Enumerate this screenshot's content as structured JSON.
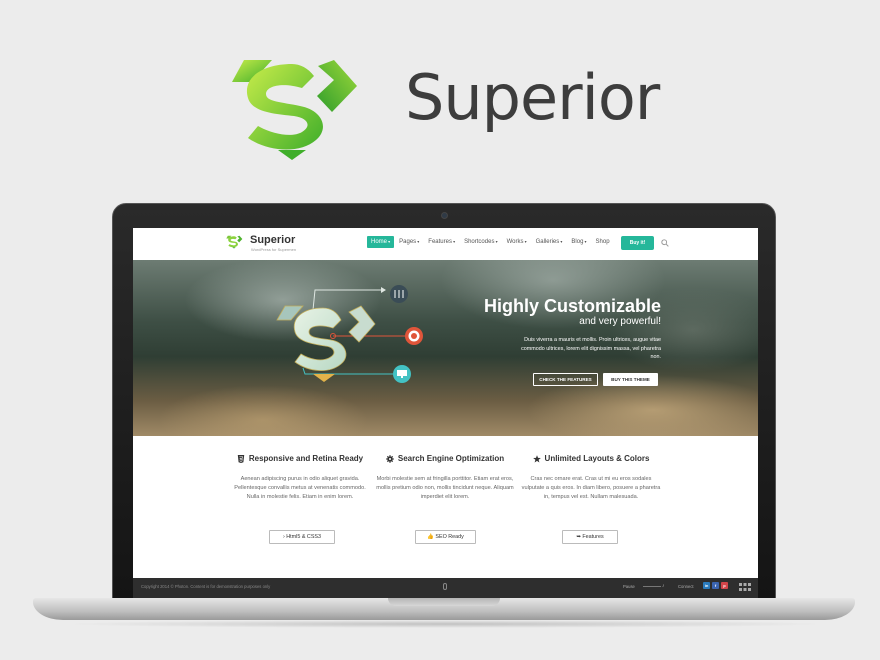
{
  "brand": {
    "name": "Superior",
    "logo_icon": "superior-s-diamond-logo",
    "colors": {
      "green_light": "#a6dc3a",
      "green_dark": "#3fae2a",
      "text": "#3d3d3d"
    }
  },
  "site": {
    "name": "Superior",
    "tagline": "WordPress for Supermen",
    "nav": {
      "items": [
        {
          "label": "Home",
          "chevron": true,
          "active": true
        },
        {
          "label": "Pages",
          "chevron": true
        },
        {
          "label": "Features",
          "chevron": true
        },
        {
          "label": "Shortcodes",
          "chevron": true
        },
        {
          "label": "Works",
          "chevron": true
        },
        {
          "label": "Galleries",
          "chevron": true
        },
        {
          "label": "Blog",
          "chevron": true
        },
        {
          "label": "Shop",
          "chevron": false
        }
      ],
      "buy_label": "Buy it!",
      "search_icon": "search-icon",
      "accent": "#25b79a"
    },
    "hero": {
      "title": "Highly Customizable",
      "subtitle": "and very powerful!",
      "text": "Duis viverra a mauris et mollis. Proin ultrices, augue vitae commodo ultrices, lorem elit dignissim massa, vel pharetra non.",
      "primary_button": "CHECK THE FEATURES",
      "secondary_button": "BUY THIS THEME",
      "icons": [
        "sliders-icon",
        "target-icon",
        "monitor-icon"
      ]
    },
    "features": [
      {
        "icon": "html5-icon",
        "title": "Responsive and Retina Ready",
        "text": "Aenean adipiscing purus in odio aliquet gravida. Pellentesque convallis metus at venenatis commodo. Nulla in molestie felis. Etiam in enim lorem.",
        "button": "Html5 & CSS3",
        "button_icon": "chevron-right-icon"
      },
      {
        "icon": "gear-icon",
        "title": "Search Engine Optimization",
        "text": "Morbi molestie sem at fringilla porttitor. Etiam erat eros, mollis pretium odio non, mollis tincidunt neque. Aliquam imperdiet elit lorem.",
        "button": "SEO Ready",
        "button_icon": "thumbs-up-icon"
      },
      {
        "icon": "star-icon",
        "title": "Unlimited Layouts & Colors",
        "text": "Cras nec ornare erat. Cras ut mi eu eros sodales vulputate a quis eros. In diam libero, posuere a pharetra in, tempus vel est. Nullam malesuada.",
        "button": "Features",
        "button_icon": "share-icon"
      }
    ],
    "footer": {
      "copyright": "Copyright 2014 © Photon. Content is for demonstration purposes only",
      "pause_label": "Pause",
      "connect_label": "Connect",
      "social": [
        {
          "icon": "linkedin-icon",
          "color": "#2a7bbd",
          "glyph": "in"
        },
        {
          "icon": "facebook-icon",
          "color": "#3b64b0",
          "glyph": "f"
        },
        {
          "icon": "pinterest-icon",
          "color": "#d2454a",
          "glyph": "p"
        }
      ]
    }
  }
}
